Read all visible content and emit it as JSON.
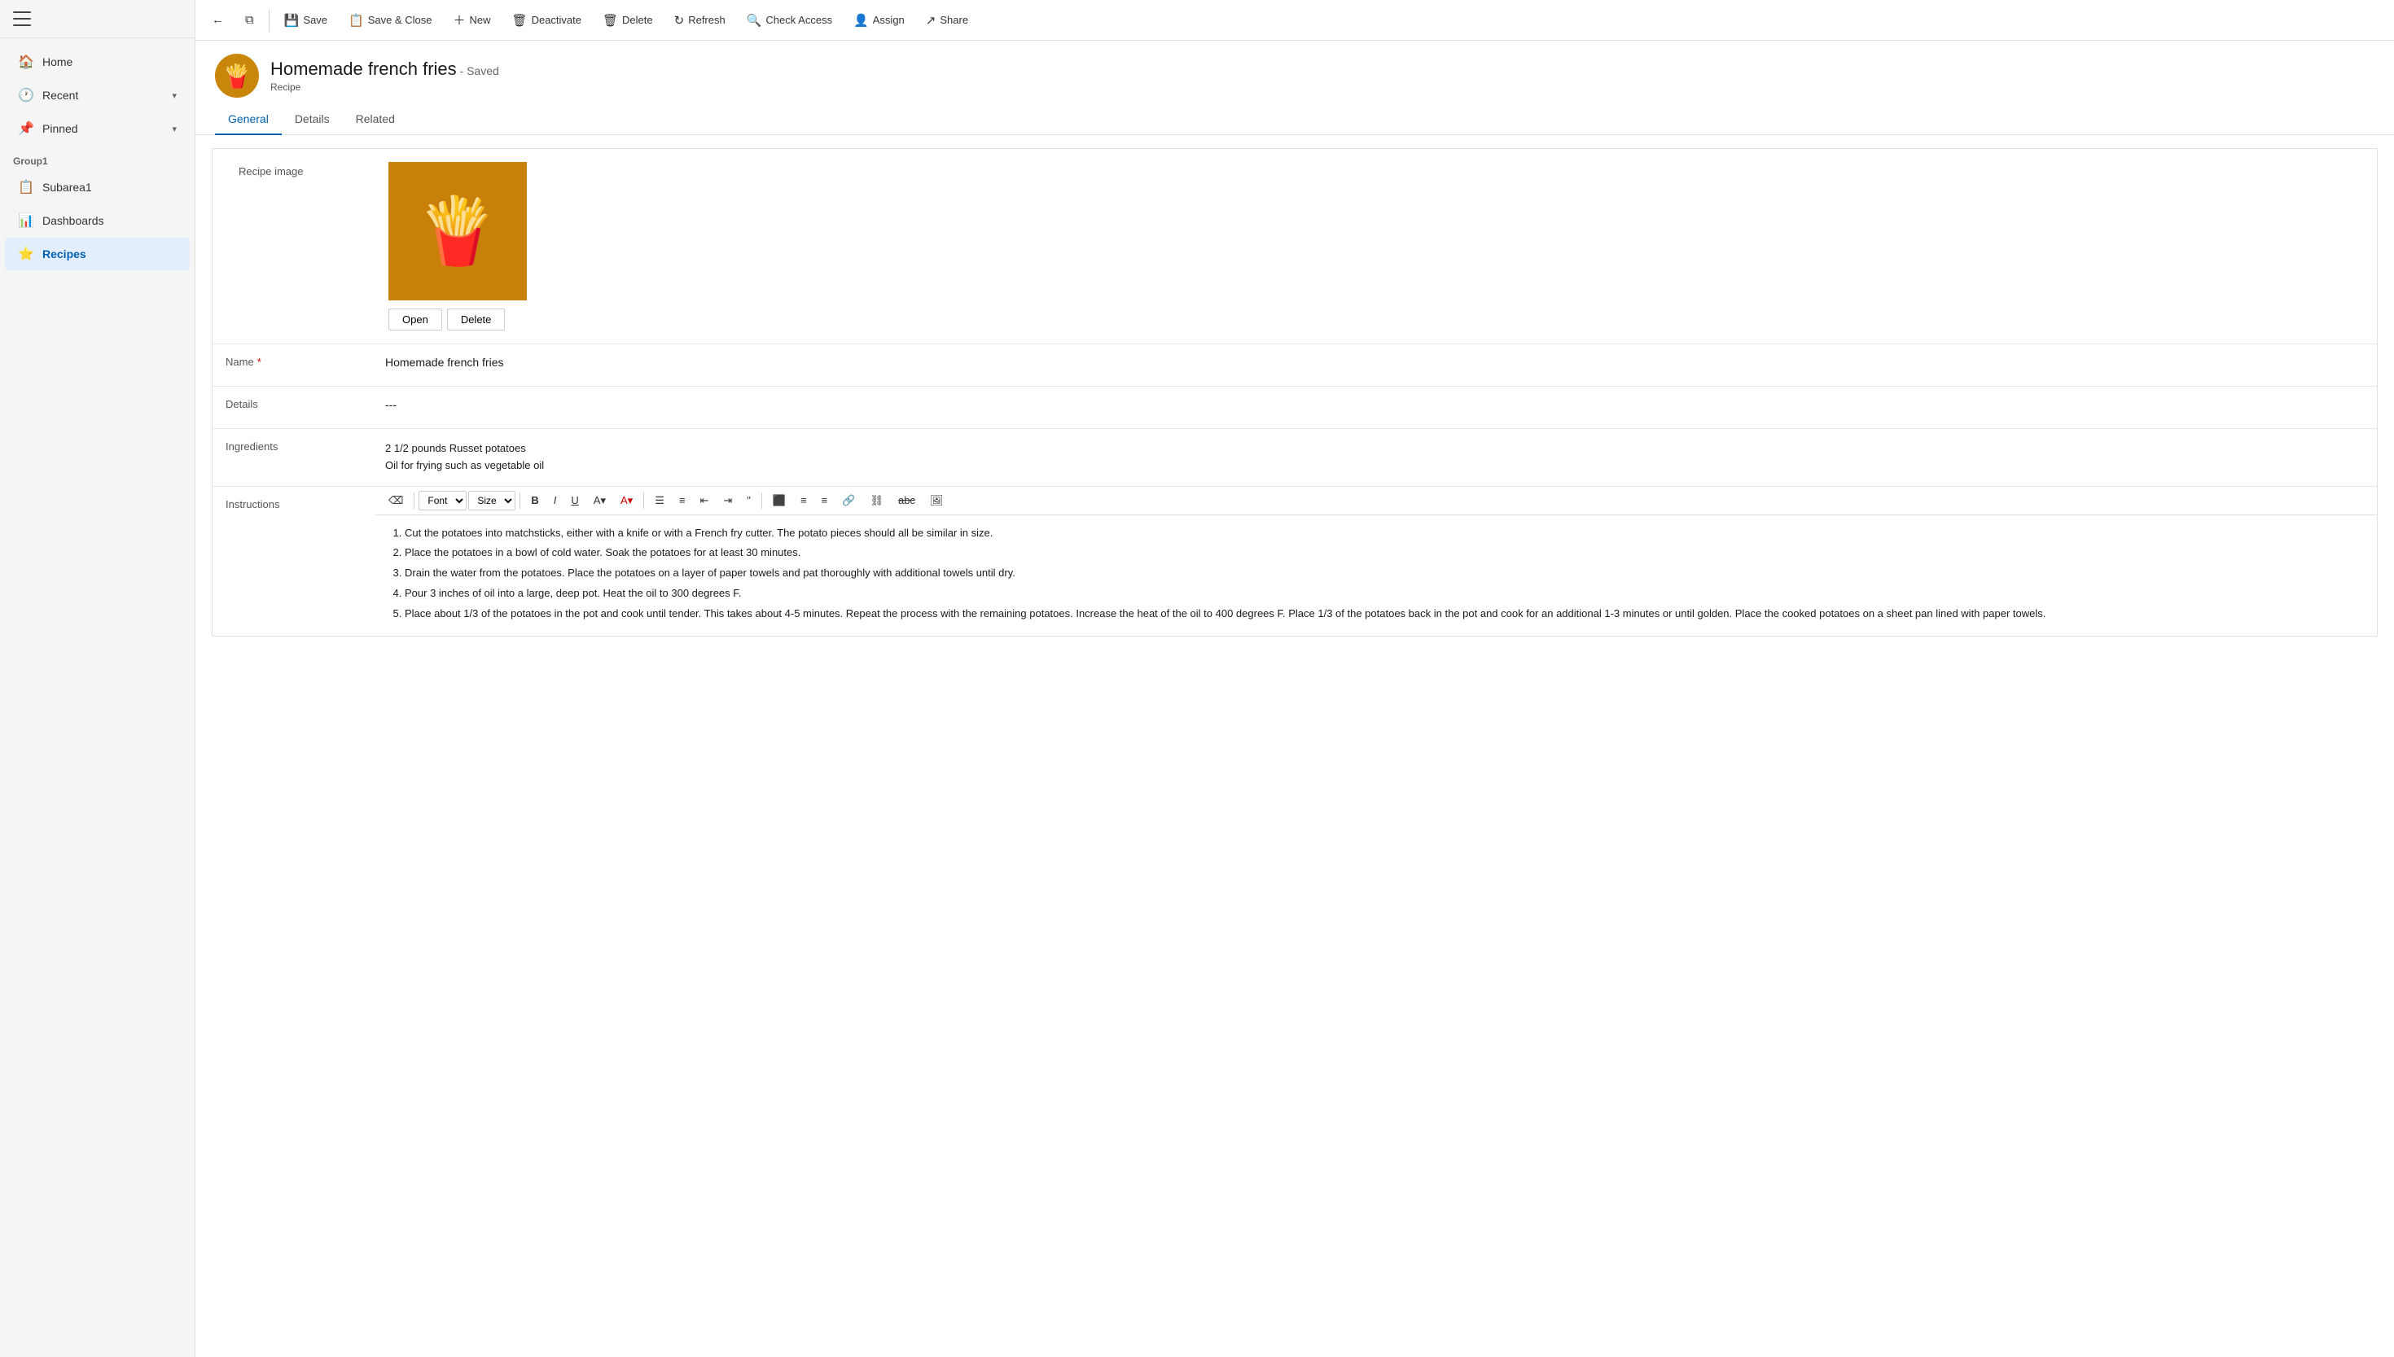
{
  "sidebar": {
    "hamburger_label": "Menu",
    "items": [
      {
        "id": "home",
        "label": "Home",
        "icon": "🏠",
        "active": false
      },
      {
        "id": "recent",
        "label": "Recent",
        "icon": "🕐",
        "active": false,
        "expandable": true
      },
      {
        "id": "pinned",
        "label": "Pinned",
        "icon": "📌",
        "active": false,
        "expandable": true
      }
    ],
    "group1_label": "Group1",
    "group_items": [
      {
        "id": "subarea1",
        "label": "Subarea1",
        "icon": "📋",
        "active": false
      },
      {
        "id": "dashboards",
        "label": "Dashboards",
        "icon": "📊",
        "active": false
      },
      {
        "id": "recipes",
        "label": "Recipes",
        "icon": "⭐",
        "active": true
      }
    ]
  },
  "toolbar": {
    "back_label": "Back",
    "open_label": "Open",
    "save_label": "Save",
    "save_close_label": "Save & Close",
    "new_label": "New",
    "deactivate_label": "Deactivate",
    "delete_label": "Delete",
    "refresh_label": "Refresh",
    "check_access_label": "Check Access",
    "assign_label": "Assign",
    "share_label": "Share"
  },
  "record": {
    "title": "Homemade french fries",
    "saved_status": "- Saved",
    "subtitle": "Recipe"
  },
  "tabs": [
    {
      "id": "general",
      "label": "General",
      "active": true
    },
    {
      "id": "details",
      "label": "Details",
      "active": false
    },
    {
      "id": "related",
      "label": "Related",
      "active": false
    }
  ],
  "form": {
    "image_label": "Recipe image",
    "open_btn": "Open",
    "delete_btn": "Delete",
    "name_label": "Name",
    "name_required": true,
    "name_value": "Homemade french fries",
    "details_label": "Details",
    "details_value": "---",
    "ingredients_label": "Ingredients",
    "ingredients_line1": "2 1/2 pounds Russet potatoes",
    "ingredients_line2": "Oil for frying such as vegetable oil",
    "instructions_label": "Instructions",
    "instructions": [
      "Cut the potatoes into matchsticks, either with a knife or with a French fry cutter. The potato pieces should all be similar in size.",
      "Place the potatoes in a bowl of cold water. Soak the potatoes for at least 30 minutes.",
      "Drain the water from the potatoes. Place the potatoes on a layer of paper towels and pat thoroughly with additional towels until dry.",
      "Pour 3 inches of oil into a large, deep pot. Heat the oil to 300 degrees F.",
      "Place about 1/3 of the potatoes in the pot and cook until tender. This takes about 4-5 minutes. Repeat the process with the remaining potatoes. Increase the heat of the oil to 400 degrees F. Place 1/3 of the potatoes back in the pot and cook for an additional 1-3 minutes or until golden. Place the cooked potatoes on a sheet pan lined with paper towels."
    ]
  },
  "rte": {
    "font_label": "Font",
    "size_label": "Size",
    "bold": "B",
    "italic": "I",
    "underline": "U"
  }
}
